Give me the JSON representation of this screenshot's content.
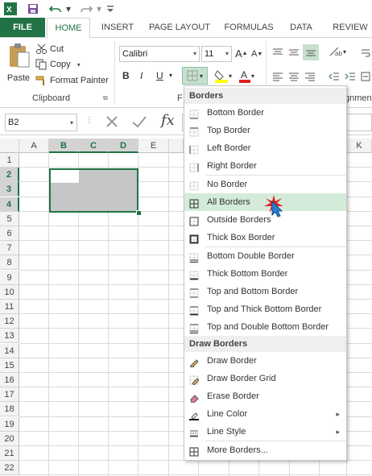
{
  "quick_access": {
    "icons": [
      "excel-icon",
      "save-icon",
      "undo-icon",
      "redo-icon",
      "customize-icon"
    ]
  },
  "tabs": [
    {
      "label": "FILE"
    },
    {
      "label": "HOME"
    },
    {
      "label": "INSERT"
    },
    {
      "label": "PAGE LAYOUT"
    },
    {
      "label": "FORMULAS"
    },
    {
      "label": "DATA"
    },
    {
      "label": "REVIEW"
    }
  ],
  "clipboard": {
    "paste_label": "Paste",
    "cut_label": "Cut",
    "copy_label": "Copy",
    "format_painter_label": "Format Painter",
    "group_label": "Clipboard"
  },
  "font": {
    "name": "Calibri",
    "size": "11",
    "bold": "B",
    "italic": "I",
    "underline": "U",
    "group_label_fragment": "F"
  },
  "alignment": {
    "group_label_fragment": "gnmen"
  },
  "formula_bar": {
    "name_box": "B2",
    "fx_label": "fx",
    "formula": ""
  },
  "grid": {
    "columns": [
      "A",
      "B",
      "C",
      "D",
      "E",
      "K"
    ],
    "selected_columns": [
      "B",
      "C",
      "D"
    ],
    "rows": [
      "1",
      "2",
      "3",
      "4",
      "5",
      "6",
      "7",
      "8",
      "9",
      "10",
      "11",
      "12",
      "13",
      "14",
      "15",
      "16",
      "17",
      "18",
      "19",
      "20",
      "21",
      "22"
    ],
    "selected_rows": [
      "2",
      "3",
      "4"
    ],
    "selection_range": "B2:D4"
  },
  "menu": {
    "borders_header": "Borders",
    "borders": [
      {
        "label": "Bottom Border",
        "icon": "bottom-border-icon"
      },
      {
        "label": "Top Border",
        "icon": "top-border-icon"
      },
      {
        "label": "Left Border",
        "icon": "left-border-icon"
      },
      {
        "label": "Right Border",
        "icon": "right-border-icon"
      },
      {
        "label": "No Border",
        "icon": "no-border-icon"
      },
      {
        "label": "All Borders",
        "icon": "all-borders-icon"
      },
      {
        "label": "Outside Borders",
        "icon": "outside-borders-icon"
      },
      {
        "label": "Thick Box Border",
        "icon": "thick-box-border-icon"
      },
      {
        "label": "Bottom Double Border",
        "icon": "bottom-double-border-icon"
      },
      {
        "label": "Thick Bottom Border",
        "icon": "thick-bottom-border-icon"
      },
      {
        "label": "Top and Bottom Border",
        "icon": "top-bottom-border-icon"
      },
      {
        "label": "Top and Thick Bottom Border",
        "icon": "top-thick-bottom-border-icon"
      },
      {
        "label": "Top and Double Bottom Border",
        "icon": "top-double-bottom-border-icon"
      }
    ],
    "draw_header": "Draw Borders",
    "draw": [
      {
        "label": "Draw Border",
        "icon": "pencil-icon"
      },
      {
        "label": "Draw Border Grid",
        "icon": "pencil-grid-icon"
      },
      {
        "label": "Erase Border",
        "icon": "eraser-icon"
      },
      {
        "label": "Line Color",
        "icon": "line-color-icon",
        "submenu": true
      },
      {
        "label": "Line Style",
        "icon": "line-style-icon",
        "submenu": true
      },
      {
        "label": "More Borders...",
        "icon": "more-borders-icon"
      }
    ],
    "highlighted": "All Borders"
  },
  "colors": {
    "accent": "#217346",
    "menu_highlight": "#d5ebd9",
    "selection_fill": "#c6c6c6",
    "cursor": "#2a7fd4",
    "click_burst": "#e02020"
  }
}
